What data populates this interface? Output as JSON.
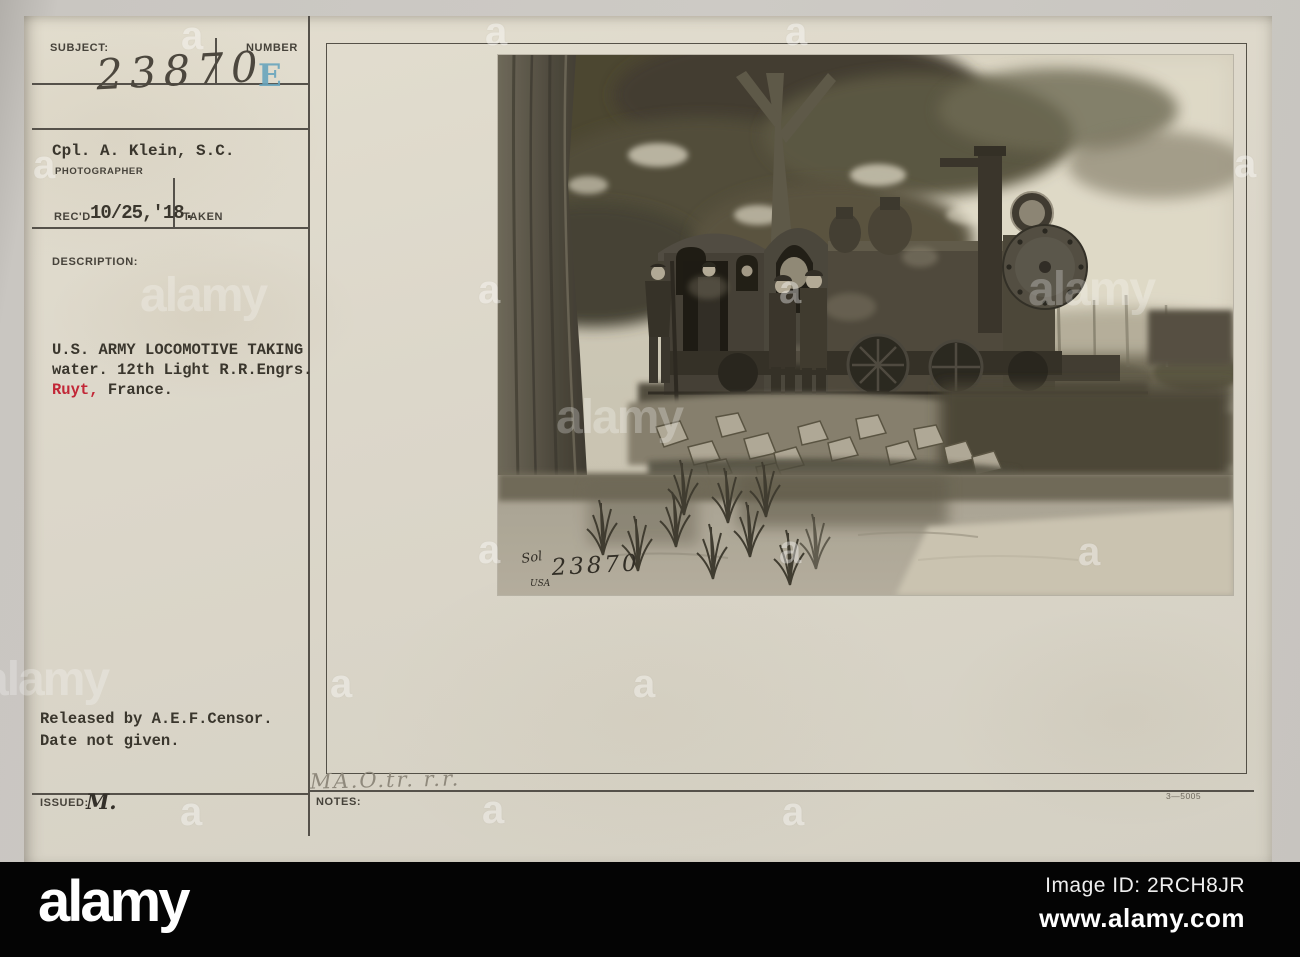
{
  "card": {
    "fields": {
      "subject_label": "SUBJECT:",
      "subject_number": "23870",
      "number_label": "NUMBER",
      "number_stamp": "E",
      "photographer_name": "Cpl. A. Klein, S.C.",
      "photographer_label": "PHOTOGRAPHER",
      "recd_label": "REC'D",
      "recd_date": "10/25,'18.",
      "taken_label": "TAKEN",
      "description_label": "DESCRIPTION:",
      "description_line1": "U.S. ARMY LOCOMOTIVE TAKING",
      "description_line2": "water. 12th Light R.R.Engrs.",
      "description_location": "Ruyt,",
      "description_country": " France.",
      "released_line1": "Released by A.E.F.Censor.",
      "released_line2": "Date not given.",
      "issued_label": "ISSUED:",
      "issued_value": "M.",
      "notes_label": "NOTES:",
      "notes_handwriting": "MA.O.tr. r.r.",
      "print_number": "3—5005"
    },
    "photo_annotations": {
      "scribble_top": "Sol",
      "caption_number": "23870",
      "scribble_bottom": "USA"
    }
  },
  "watermark": {
    "brand": "alamy",
    "letter": "a"
  },
  "footer": {
    "logo": "alamy",
    "image_id": "Image ID: 2RCH8JR",
    "url": "www.alamy.com"
  },
  "colors": {
    "card_paper": "#dcd7ca",
    "background": "#c9c6c1",
    "typed_ink": "#3a362d",
    "red_ink": "#c22737",
    "blue_stamp": "#69a5bd",
    "pencil": "#8f897c",
    "footer_bar": "#040404"
  }
}
